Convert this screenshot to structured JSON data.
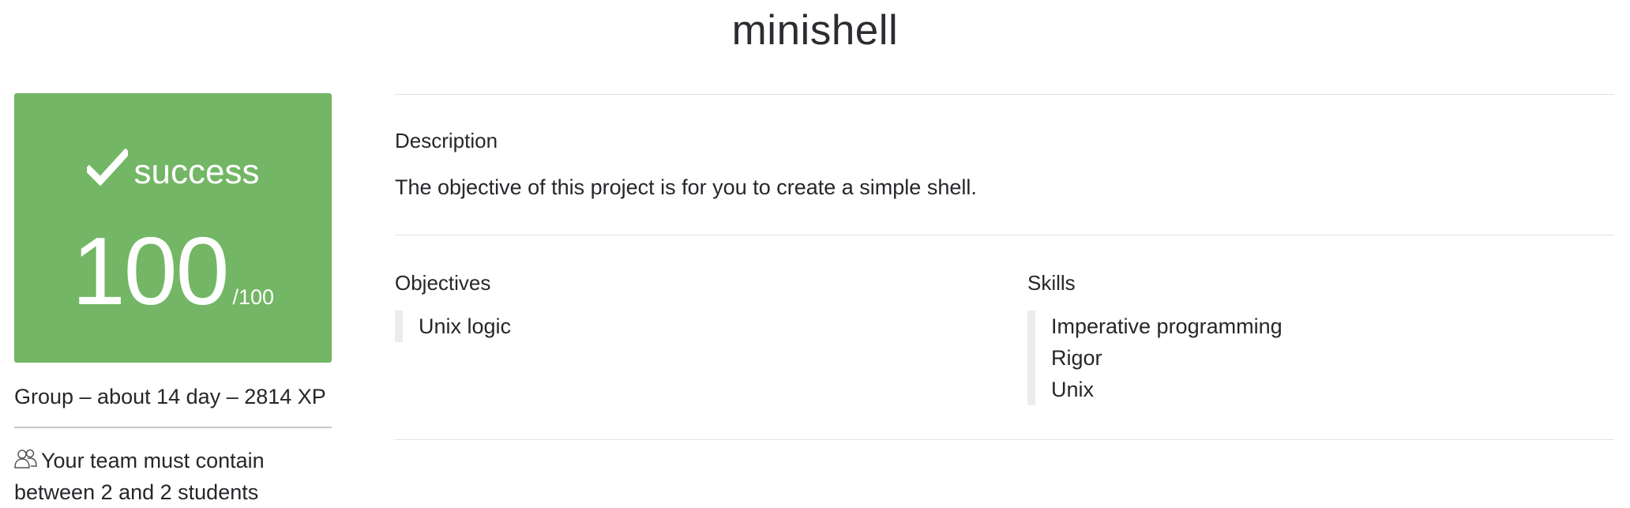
{
  "project": {
    "title": "minishell"
  },
  "result": {
    "status": "success",
    "score": "100",
    "max_score": "/100",
    "card_color": "#73b665"
  },
  "meta": {
    "summary": "Group – about 14 day – 2814 XP",
    "team_icon": "users-icon",
    "team_note": "Your team must contain between 2 and 2 students"
  },
  "description": {
    "heading": "Description",
    "text": "The objective of this project is for you to create a simple shell."
  },
  "objectives": {
    "heading": "Objectives",
    "items": [
      "Unix logic"
    ]
  },
  "skills": {
    "heading": "Skills",
    "items": [
      "Imperative programming",
      "Rigor",
      "Unix"
    ]
  }
}
